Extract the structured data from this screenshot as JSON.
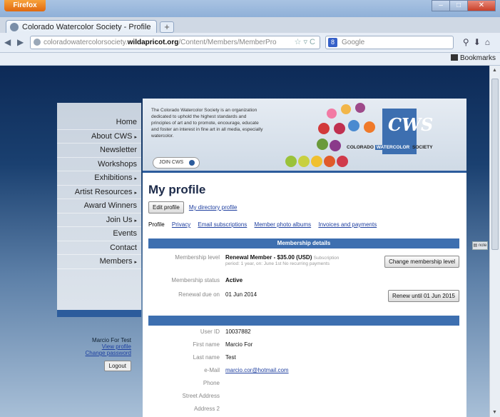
{
  "browser": {
    "menu_label": "Firefox",
    "tab_title": "Colorado Watercolor Society - Profile",
    "url_prefix": "coloradowatercolorsociety.",
    "url_domain": "wildapricot.org",
    "url_path": "/Content/Members/MemberPro",
    "search_placeholder": "Google",
    "bookmarks_label": "Bookmarks"
  },
  "header": {
    "blurb": "The Colorado Watercolor Society is an organization dedicated to uphold the highest standards and principles of art and to promote, encourage, educate and foster an interest in fine art in all media, especially watercolor.",
    "join_label": "JOIN CWS",
    "logo_mark": "CWS",
    "logo_colorado": "COLORADO",
    "logo_watercolor": "WATERCOLOR",
    "logo_society": "SOCIETY"
  },
  "nav": {
    "items": [
      {
        "label": "Home",
        "arrow": ""
      },
      {
        "label": "About CWS",
        "arrow": "▸"
      },
      {
        "label": "Newsletter",
        "arrow": ""
      },
      {
        "label": "Workshops",
        "arrow": ""
      },
      {
        "label": "Exhibitions",
        "arrow": "▸"
      },
      {
        "label": "Artist Resources",
        "arrow": "▸"
      },
      {
        "label": "Award Winners",
        "arrow": ""
      },
      {
        "label": "Join Us",
        "arrow": "▸"
      },
      {
        "label": "Events",
        "arrow": ""
      },
      {
        "label": "Contact",
        "arrow": ""
      },
      {
        "label": "Members",
        "arrow": "▸"
      }
    ]
  },
  "login": {
    "name": "Marcio For Test",
    "view_profile": "View profile",
    "change_password": "Change password",
    "logout": "Logout"
  },
  "profile": {
    "title": "My profile",
    "edit_button": "Edit profile",
    "directory_link": "My directory profile",
    "tabs": [
      "Profile",
      "Privacy",
      "Email subscriptions",
      "Member photo albums",
      "Invoices and payments"
    ],
    "membership_header": "Membership details",
    "level_label": "Membership level",
    "level_value": "Renewal Member - $35.00 (USD)",
    "level_sub": "Subscription",
    "level_note": "period: 1 year, on: June 1st No recurring payments",
    "change_level_button": "Change membership level",
    "status_label": "Membership status",
    "status_value": "Active",
    "renewal_label": "Renewal due on",
    "renewal_value": "01 Jun 2014",
    "renew_button": "Renew until 01 Jun 2015",
    "fields": [
      {
        "label": "User ID",
        "value": "10037882"
      },
      {
        "label": "First name",
        "value": "Marcio For"
      },
      {
        "label": "Last name",
        "value": "Test"
      },
      {
        "label": "e-Mail",
        "value": "marcio.cor@hotmail.com"
      },
      {
        "label": "Phone",
        "value": ""
      },
      {
        "label": "Street Address",
        "value": ""
      },
      {
        "label": "Address 2",
        "value": ""
      }
    ]
  },
  "colors": {
    "accent": "#3d6fb0",
    "nav_dark": "#2c5c9c"
  }
}
